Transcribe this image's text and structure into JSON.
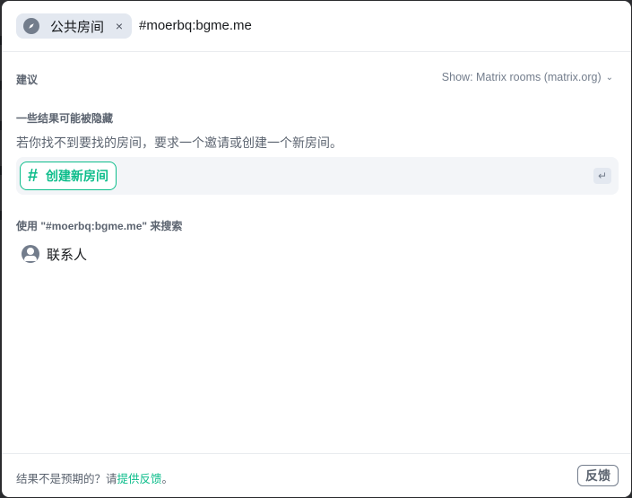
{
  "search": {
    "scope_label": "公共房间",
    "scope_icon": "compass-icon",
    "remove_scope": "×",
    "query": "#moerbq:bgme.me"
  },
  "suggestions": {
    "heading": "建议",
    "show_selector": "Show: Matrix rooms (matrix.org)"
  },
  "hidden_results": {
    "heading": "一些结果可能被隐藏",
    "hint": "若你找不到要找的房间，要求一个邀请或创建一个新房间。",
    "create_label": "创建新房间",
    "enter_key": "↵"
  },
  "search_with": {
    "heading": "使用 \"#moerbq:bgme.me\" 来搜索",
    "people_label": "联系人"
  },
  "footer": {
    "prefix": "结果不是预期的？请",
    "link": "提供反馈",
    "suffix": "。",
    "button": "反馈"
  },
  "colors": {
    "accent": "#0dbd8b",
    "secondary_text": "#737d8c",
    "pill_bg": "#e3e8f0"
  }
}
